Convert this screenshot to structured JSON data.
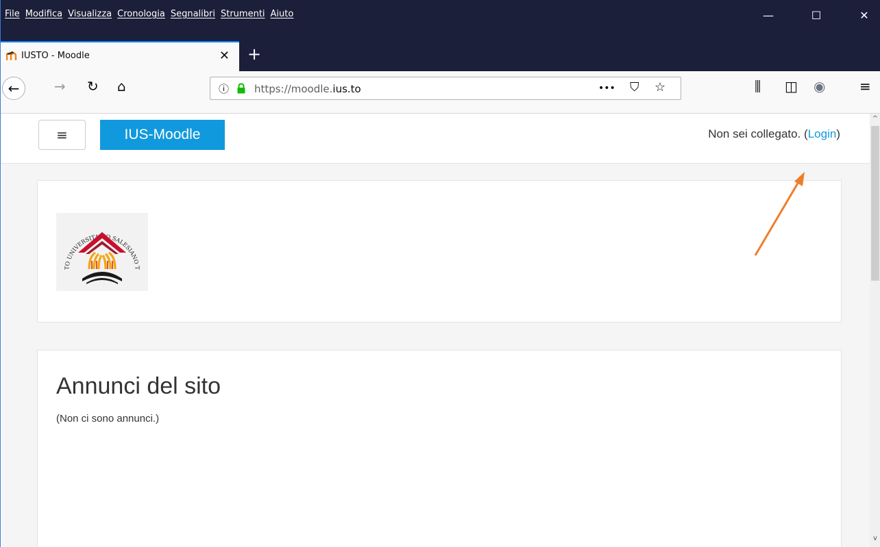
{
  "menu": [
    "File",
    "Modifica",
    "Visualizza",
    "Cronologia",
    "Segnalibri",
    "Strumenti",
    "Aiuto"
  ],
  "window_controls": {
    "minimize": "—",
    "maximize": "☐",
    "close": "✕"
  },
  "tab": {
    "title": "IUSTO - Moodle",
    "close": "✕",
    "new_tab": "+"
  },
  "navigation": {
    "back": "←",
    "forward": "→",
    "reload": "↻",
    "home": "⌂"
  },
  "urlbar": {
    "info": "ⓘ",
    "url_prefix": "https://moodle.",
    "url_domain": "ius.to",
    "more": "•••",
    "pocket": "⛉",
    "bookmark": "☆"
  },
  "toolbar_right": {
    "library": "⫼",
    "sidebar": "◫",
    "extension": "◉",
    "menu": "≡"
  },
  "site": {
    "hamburger": "≡",
    "brand": "IUS-Moodle",
    "login_prefix": "Non sei collegato. (",
    "login_link": "Login",
    "login_suffix": ")",
    "logo_text": "ISTITUTO UNIVERSITARIO SALESIANO TORINO"
  },
  "news": {
    "title": "Annunci del sito",
    "empty": "(Non ci sono annunci.)"
  },
  "colors": {
    "accent": "#1199dd",
    "titlebar": "#1c1f39",
    "arrow": "#ef7d2b"
  },
  "icons": {
    "favicon": "moodle-icon",
    "lock": "lock-icon",
    "logo": "iusto-logo"
  }
}
